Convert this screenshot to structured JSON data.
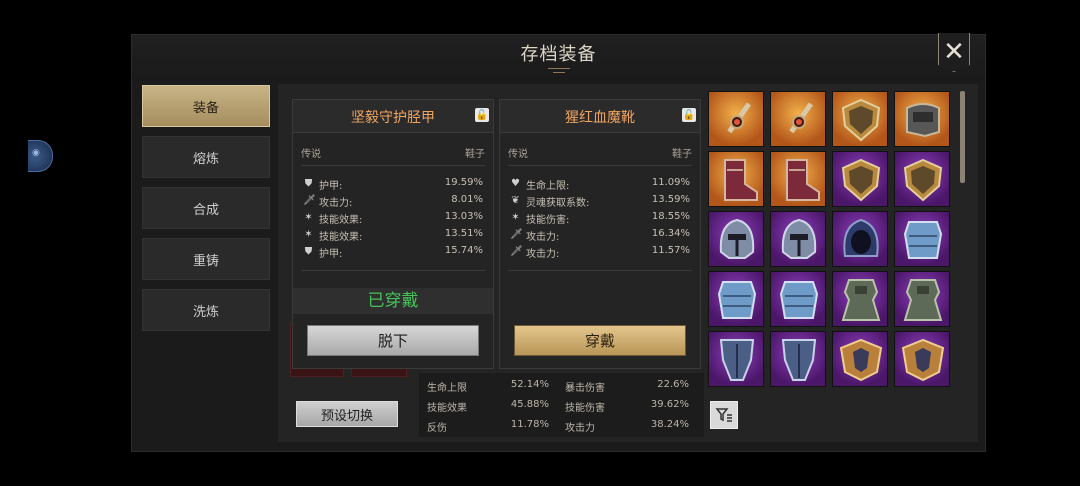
{
  "dialog": {
    "title": "存档装备"
  },
  "tabs": [
    {
      "label": "装备",
      "active": true
    },
    {
      "label": "熔炼"
    },
    {
      "label": "合成"
    },
    {
      "label": "重铸"
    },
    {
      "label": "洗炼"
    }
  ],
  "preset_button": "预设切换",
  "left_card": {
    "title": "坚毅守护胫甲",
    "rarity": "传说",
    "slot_type": "鞋子",
    "stats": [
      {
        "icon": "shield-icon",
        "name": "护甲:",
        "value": "19.59%"
      },
      {
        "icon": "sword-icon",
        "name": "攻击力:",
        "value": "8.01%"
      },
      {
        "icon": "skill-icon",
        "name": "技能效果:",
        "value": "13.03%"
      },
      {
        "icon": "skill-icon",
        "name": "技能效果:",
        "value": "13.51%"
      },
      {
        "icon": "shield-icon",
        "name": "护甲:",
        "value": "15.74%"
      }
    ],
    "status": "已穿戴",
    "action": "脱下"
  },
  "right_card": {
    "title": "猩红血魔靴",
    "rarity": "传说",
    "slot_type": "鞋子",
    "stats": [
      {
        "icon": "heart-icon",
        "name": "生命上限:",
        "value": "11.09%"
      },
      {
        "icon": "soul-icon",
        "name": "灵魂获取系数:",
        "value": "13.59%"
      },
      {
        "icon": "skill-icon",
        "name": "技能伤害:",
        "value": "18.55%"
      },
      {
        "icon": "sword-icon",
        "name": "攻击力:",
        "value": "16.34%"
      },
      {
        "icon": "sword-icon",
        "name": "攻击力:",
        "value": "11.57%"
      }
    ],
    "action": "穿戴"
  },
  "summary_stats": {
    "rows": [
      [
        "生命上限",
        "52.14%",
        "暴击伤害",
        "22.6%"
      ],
      [
        "技能效果",
        "45.88%",
        "技能伤害",
        "39.62%"
      ],
      [
        "反伤",
        "11.78%",
        "攻击力",
        "38.24%"
      ]
    ]
  },
  "inventory": [
    {
      "icon": "sword-icon",
      "bg": "orange"
    },
    {
      "icon": "sword-icon",
      "bg": "orange"
    },
    {
      "icon": "shield-icon",
      "bg": "orange"
    },
    {
      "icon": "gauntlet-icon",
      "bg": "orange"
    },
    {
      "icon": "boot-icon",
      "bg": "orange"
    },
    {
      "icon": "boot-icon",
      "bg": "orange"
    },
    {
      "icon": "shield-icon",
      "bg": "purple"
    },
    {
      "icon": "shield-icon",
      "bg": "purple"
    },
    {
      "icon": "helmet-icon",
      "bg": "purple"
    },
    {
      "icon": "helmet-icon",
      "bg": "purple"
    },
    {
      "icon": "hood-icon",
      "bg": "purple"
    },
    {
      "icon": "chest-armor-icon",
      "bg": "purple"
    },
    {
      "icon": "chest-armor-icon",
      "bg": "purple"
    },
    {
      "icon": "chest-armor-icon",
      "bg": "purple"
    },
    {
      "icon": "robe-icon",
      "bg": "purple"
    },
    {
      "icon": "robe-icon",
      "bg": "purple"
    },
    {
      "icon": "leg-armor-icon",
      "bg": "purple"
    },
    {
      "icon": "leg-armor-icon",
      "bg": "purple"
    },
    {
      "icon": "collar-icon",
      "bg": "purple"
    },
    {
      "icon": "collar-icon",
      "bg": "purple"
    }
  ],
  "colors": {
    "accent_gold": "#b89556",
    "rarity_legendary": "#f0a560",
    "equipped_green": "#45c25a"
  }
}
